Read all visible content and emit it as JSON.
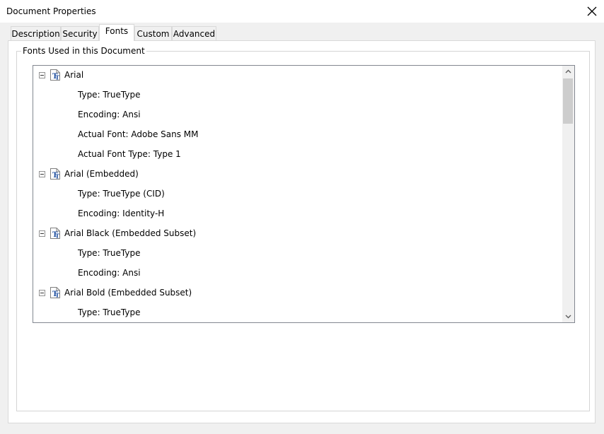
{
  "window": {
    "title": "Document Properties"
  },
  "tabs": [
    {
      "label": "Description",
      "active": false
    },
    {
      "label": "Security",
      "active": false
    },
    {
      "label": "Fonts",
      "active": true
    },
    {
      "label": "Custom",
      "active": false
    },
    {
      "label": "Advanced",
      "active": false
    }
  ],
  "group": {
    "label": "Fonts Used in this Document"
  },
  "fonts": [
    {
      "name": "Arial",
      "details": [
        "Type: TrueType",
        "Encoding: Ansi",
        "Actual Font: Adobe Sans MM",
        "Actual Font Type: Type 1"
      ]
    },
    {
      "name": "Arial (Embedded)",
      "details": [
        "Type: TrueType (CID)",
        "Encoding: Identity-H"
      ]
    },
    {
      "name": "Arial Black (Embedded Subset)",
      "details": [
        "Type: TrueType",
        "Encoding: Ansi"
      ]
    },
    {
      "name": "Arial Bold (Embedded Subset)",
      "details": [
        "Type: TrueType"
      ]
    }
  ],
  "icons": {
    "font": "truetype-font-icon",
    "close": "close-icon",
    "expander": "collapse-icon"
  },
  "colors": {
    "background": "#f0f0f0",
    "border": "#d9d9d9",
    "tree_border": "#828790",
    "icon_blue": "#1f4fa0"
  }
}
